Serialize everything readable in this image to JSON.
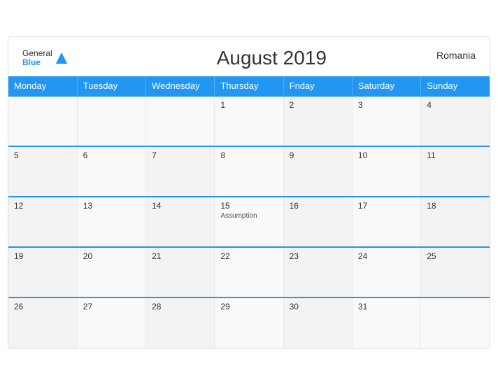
{
  "header": {
    "logo_general": "General",
    "logo_blue": "Blue",
    "title": "August 2019",
    "country": "Romania"
  },
  "weekdays": [
    "Monday",
    "Tuesday",
    "Wednesday",
    "Thursday",
    "Friday",
    "Saturday",
    "Sunday"
  ],
  "weeks": [
    [
      {
        "day": "",
        "holiday": ""
      },
      {
        "day": "",
        "holiday": ""
      },
      {
        "day": "",
        "holiday": ""
      },
      {
        "day": "1",
        "holiday": ""
      },
      {
        "day": "2",
        "holiday": ""
      },
      {
        "day": "3",
        "holiday": ""
      },
      {
        "day": "4",
        "holiday": ""
      }
    ],
    [
      {
        "day": "5",
        "holiday": ""
      },
      {
        "day": "6",
        "holiday": ""
      },
      {
        "day": "7",
        "holiday": ""
      },
      {
        "day": "8",
        "holiday": ""
      },
      {
        "day": "9",
        "holiday": ""
      },
      {
        "day": "10",
        "holiday": ""
      },
      {
        "day": "11",
        "holiday": ""
      }
    ],
    [
      {
        "day": "12",
        "holiday": ""
      },
      {
        "day": "13",
        "holiday": ""
      },
      {
        "day": "14",
        "holiday": ""
      },
      {
        "day": "15",
        "holiday": "Assumption"
      },
      {
        "day": "16",
        "holiday": ""
      },
      {
        "day": "17",
        "holiday": ""
      },
      {
        "day": "18",
        "holiday": ""
      }
    ],
    [
      {
        "day": "19",
        "holiday": ""
      },
      {
        "day": "20",
        "holiday": ""
      },
      {
        "day": "21",
        "holiday": ""
      },
      {
        "day": "22",
        "holiday": ""
      },
      {
        "day": "23",
        "holiday": ""
      },
      {
        "day": "24",
        "holiday": ""
      },
      {
        "day": "25",
        "holiday": ""
      }
    ],
    [
      {
        "day": "26",
        "holiday": ""
      },
      {
        "day": "27",
        "holiday": ""
      },
      {
        "day": "28",
        "holiday": ""
      },
      {
        "day": "29",
        "holiday": ""
      },
      {
        "day": "30",
        "holiday": ""
      },
      {
        "day": "31",
        "holiday": ""
      },
      {
        "day": "",
        "holiday": ""
      }
    ]
  ]
}
